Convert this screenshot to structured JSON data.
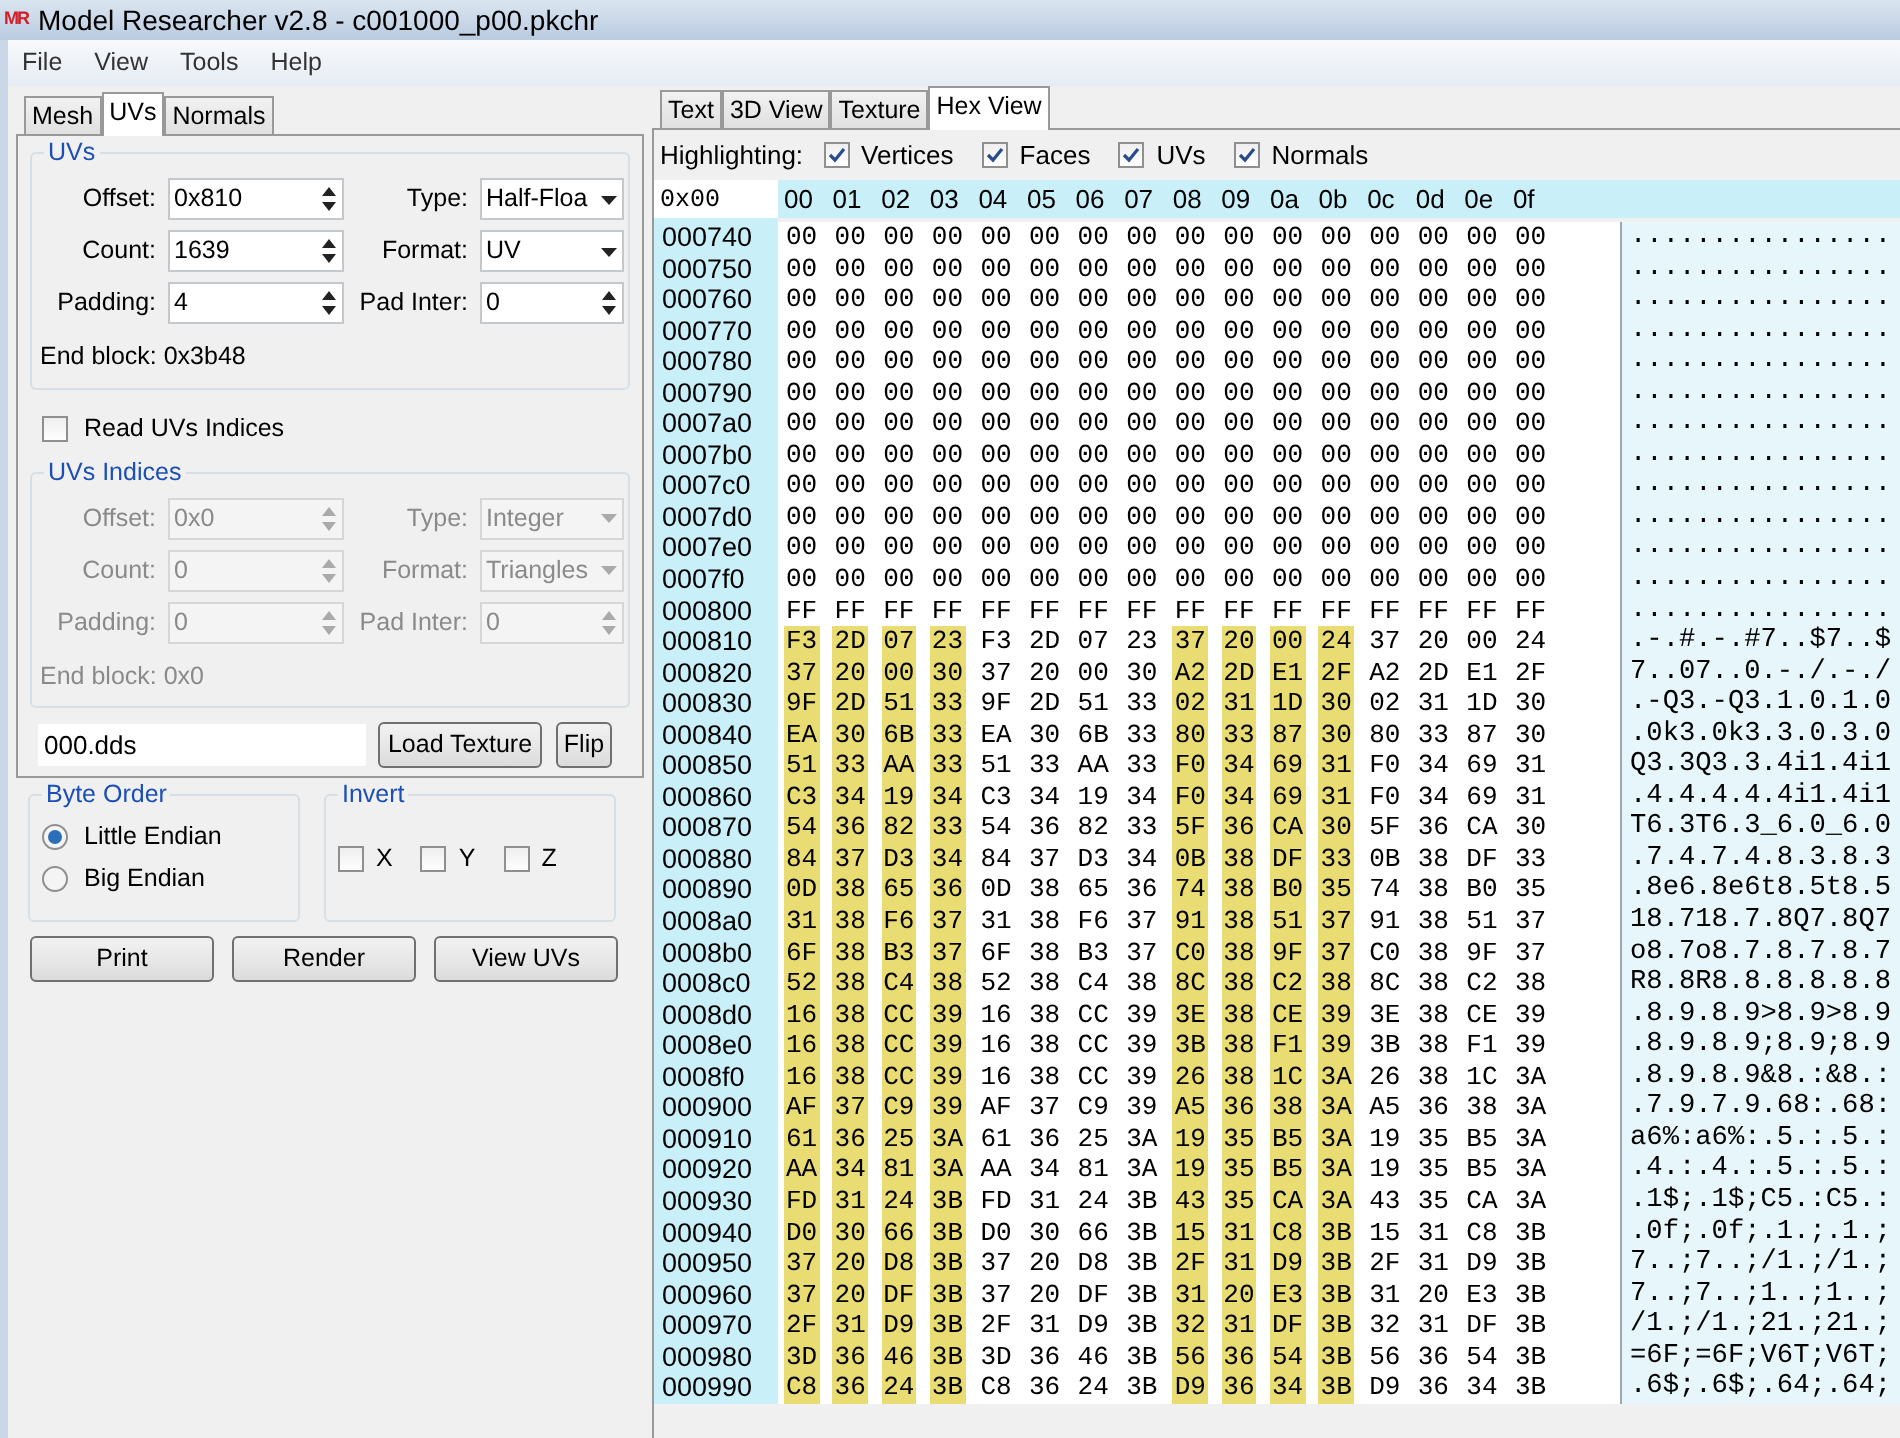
{
  "window": {
    "logo": "MR",
    "title": "Model Researcher v2.8 - c001000_p00.pkchr"
  },
  "menu": [
    "File",
    "View",
    "Tools",
    "Help"
  ],
  "left_tabs": [
    {
      "label": "Mesh",
      "selected": false
    },
    {
      "label": "UVs",
      "selected": true
    },
    {
      "label": "Normals",
      "selected": false
    }
  ],
  "uvs": {
    "title": "UVs",
    "disabled": false,
    "fields": [
      {
        "label": "Offset:",
        "value": "0x810",
        "kind": "spin"
      },
      {
        "label": "Type:",
        "value": "Half-Floa",
        "kind": "combo"
      },
      {
        "label": "Count:",
        "value": "1639",
        "kind": "spin"
      },
      {
        "label": "Format:",
        "value": "UV",
        "kind": "combo"
      },
      {
        "label": "Padding:",
        "value": "4",
        "kind": "spin"
      },
      {
        "label": "Pad Inter:",
        "value": "0",
        "kind": "spin"
      }
    ],
    "end_block": "End block: 0x3b48"
  },
  "read_indices": {
    "label": "Read UVs Indices",
    "checked": false
  },
  "uv_indices": {
    "title": "UVs Indices",
    "disabled": true,
    "fields": [
      {
        "label": "Offset:",
        "value": "0x0",
        "kind": "spin"
      },
      {
        "label": "Type:",
        "value": "Integer",
        "kind": "combo"
      },
      {
        "label": "Count:",
        "value": "0",
        "kind": "spin"
      },
      {
        "label": "Format:",
        "value": "Triangles",
        "kind": "combo"
      },
      {
        "label": "Padding:",
        "value": "0",
        "kind": "spin"
      },
      {
        "label": "Pad Inter:",
        "value": "0",
        "kind": "spin"
      }
    ],
    "end_block": "End block: 0x0"
  },
  "texture": {
    "value": "000.dds",
    "buttons": [
      "Load Texture",
      "Flip"
    ]
  },
  "byte_order": {
    "title": "Byte Order",
    "options": [
      {
        "label": "Little Endian",
        "selected": true
      },
      {
        "label": "Big Endian",
        "selected": false
      }
    ]
  },
  "invert": {
    "title": "Invert",
    "options": [
      {
        "label": "X",
        "checked": false
      },
      {
        "label": "Y",
        "checked": false
      },
      {
        "label": "Z",
        "checked": false
      }
    ]
  },
  "buttons": [
    "Print",
    "Render",
    "View UVs"
  ],
  "view_tabs": [
    {
      "label": "Text",
      "selected": false
    },
    {
      "label": "3D View",
      "selected": false
    },
    {
      "label": "Texture",
      "selected": false
    },
    {
      "label": "Hex View",
      "selected": true
    }
  ],
  "highlighting": {
    "label": "Highlighting:",
    "options": [
      {
        "label": "Vertices",
        "checked": true
      },
      {
        "label": "Faces",
        "checked": true
      },
      {
        "label": "UVs",
        "checked": true
      },
      {
        "label": "Normals",
        "checked": true
      }
    ]
  },
  "hex": {
    "offset_field": "0x00",
    "columns": [
      "00",
      "01",
      "02",
      "03",
      "04",
      "05",
      "06",
      "07",
      "08",
      "09",
      "0a",
      "0b",
      "0c",
      "0d",
      "0e",
      "0f"
    ],
    "rows": [
      {
        "address": "000740",
        "bytes": "00 00 00 00 00 00 00 00 00 00 00 00 00 00 00 00",
        "highlighted": [
          false,
          false,
          false,
          false,
          false,
          false,
          false,
          false,
          false,
          false,
          false,
          false,
          false,
          false,
          false,
          false
        ],
        "ascii": "................"
      },
      {
        "address": "000750",
        "bytes": "00 00 00 00 00 00 00 00 00 00 00 00 00 00 00 00",
        "highlighted": [
          false,
          false,
          false,
          false,
          false,
          false,
          false,
          false,
          false,
          false,
          false,
          false,
          false,
          false,
          false,
          false
        ],
        "ascii": "................"
      },
      {
        "address": "000760",
        "bytes": "00 00 00 00 00 00 00 00 00 00 00 00 00 00 00 00",
        "highlighted": [
          false,
          false,
          false,
          false,
          false,
          false,
          false,
          false,
          false,
          false,
          false,
          false,
          false,
          false,
          false,
          false
        ],
        "ascii": "................"
      },
      {
        "address": "000770",
        "bytes": "00 00 00 00 00 00 00 00 00 00 00 00 00 00 00 00",
        "highlighted": [
          false,
          false,
          false,
          false,
          false,
          false,
          false,
          false,
          false,
          false,
          false,
          false,
          false,
          false,
          false,
          false
        ],
        "ascii": "................"
      },
      {
        "address": "000780",
        "bytes": "00 00 00 00 00 00 00 00 00 00 00 00 00 00 00 00",
        "highlighted": [
          false,
          false,
          false,
          false,
          false,
          false,
          false,
          false,
          false,
          false,
          false,
          false,
          false,
          false,
          false,
          false
        ],
        "ascii": "................"
      },
      {
        "address": "000790",
        "bytes": "00 00 00 00 00 00 00 00 00 00 00 00 00 00 00 00",
        "highlighted": [
          false,
          false,
          false,
          false,
          false,
          false,
          false,
          false,
          false,
          false,
          false,
          false,
          false,
          false,
          false,
          false
        ],
        "ascii": "................"
      },
      {
        "address": "0007a0",
        "bytes": "00 00 00 00 00 00 00 00 00 00 00 00 00 00 00 00",
        "highlighted": [
          false,
          false,
          false,
          false,
          false,
          false,
          false,
          false,
          false,
          false,
          false,
          false,
          false,
          false,
          false,
          false
        ],
        "ascii": "................"
      },
      {
        "address": "0007b0",
        "bytes": "00 00 00 00 00 00 00 00 00 00 00 00 00 00 00 00",
        "highlighted": [
          false,
          false,
          false,
          false,
          false,
          false,
          false,
          false,
          false,
          false,
          false,
          false,
          false,
          false,
          false,
          false
        ],
        "ascii": "................"
      },
      {
        "address": "0007c0",
        "bytes": "00 00 00 00 00 00 00 00 00 00 00 00 00 00 00 00",
        "highlighted": [
          false,
          false,
          false,
          false,
          false,
          false,
          false,
          false,
          false,
          false,
          false,
          false,
          false,
          false,
          false,
          false
        ],
        "ascii": "................"
      },
      {
        "address": "0007d0",
        "bytes": "00 00 00 00 00 00 00 00 00 00 00 00 00 00 00 00",
        "highlighted": [
          false,
          false,
          false,
          false,
          false,
          false,
          false,
          false,
          false,
          false,
          false,
          false,
          false,
          false,
          false,
          false
        ],
        "ascii": "................"
      },
      {
        "address": "0007e0",
        "bytes": "00 00 00 00 00 00 00 00 00 00 00 00 00 00 00 00",
        "highlighted": [
          false,
          false,
          false,
          false,
          false,
          false,
          false,
          false,
          false,
          false,
          false,
          false,
          false,
          false,
          false,
          false
        ],
        "ascii": "................"
      },
      {
        "address": "0007f0",
        "bytes": "00 00 00 00 00 00 00 00 00 00 00 00 00 00 00 00",
        "highlighted": [
          false,
          false,
          false,
          false,
          false,
          false,
          false,
          false,
          false,
          false,
          false,
          false,
          false,
          false,
          false,
          false
        ],
        "ascii": "................"
      },
      {
        "address": "000800",
        "bytes": "FF FF FF FF FF FF FF FF FF FF FF FF FF FF FF FF",
        "highlighted": [
          false,
          false,
          false,
          false,
          false,
          false,
          false,
          false,
          false,
          false,
          false,
          false,
          false,
          false,
          false,
          false
        ],
        "ascii": "................"
      },
      {
        "address": "000810",
        "bytes": "F3 2D 07 23 F3 2D 07 23 37 20 00 24 37 20 00 24",
        "highlighted": [
          true,
          true,
          true,
          true,
          false,
          false,
          false,
          false,
          true,
          true,
          true,
          true,
          false,
          false,
          false,
          false
        ],
        "ascii": ".-.#.-.#7..$7..$"
      },
      {
        "address": "000820",
        "bytes": "37 20 00 30 37 20 00 30 A2 2D E1 2F A2 2D E1 2F",
        "highlighted": [
          true,
          true,
          true,
          true,
          false,
          false,
          false,
          false,
          true,
          true,
          true,
          true,
          false,
          false,
          false,
          false
        ],
        "ascii": "7..07..0.-./.-./"
      },
      {
        "address": "000830",
        "bytes": "9F 2D 51 33 9F 2D 51 33 02 31 1D 30 02 31 1D 30",
        "highlighted": [
          true,
          true,
          true,
          true,
          false,
          false,
          false,
          false,
          true,
          true,
          true,
          true,
          false,
          false,
          false,
          false
        ],
        "ascii": ".-Q3.-Q3.1.0.1.0"
      },
      {
        "address": "000840",
        "bytes": "EA 30 6B 33 EA 30 6B 33 80 33 87 30 80 33 87 30",
        "highlighted": [
          true,
          true,
          true,
          true,
          false,
          false,
          false,
          false,
          true,
          true,
          true,
          true,
          false,
          false,
          false,
          false
        ],
        "ascii": ".0k3.0k3.3.0.3.0"
      },
      {
        "address": "000850",
        "bytes": "51 33 AA 33 51 33 AA 33 F0 34 69 31 F0 34 69 31",
        "highlighted": [
          true,
          true,
          true,
          true,
          false,
          false,
          false,
          false,
          true,
          true,
          true,
          true,
          false,
          false,
          false,
          false
        ],
        "ascii": "Q3.3Q3.3.4i1.4i1"
      },
      {
        "address": "000860",
        "bytes": "C3 34 19 34 C3 34 19 34 F0 34 69 31 F0 34 69 31",
        "highlighted": [
          true,
          true,
          true,
          true,
          false,
          false,
          false,
          false,
          true,
          true,
          true,
          true,
          false,
          false,
          false,
          false
        ],
        "ascii": ".4.4.4.4.4i1.4i1"
      },
      {
        "address": "000870",
        "bytes": "54 36 82 33 54 36 82 33 5F 36 CA 30 5F 36 CA 30",
        "highlighted": [
          true,
          true,
          true,
          true,
          false,
          false,
          false,
          false,
          true,
          true,
          true,
          true,
          false,
          false,
          false,
          false
        ],
        "ascii": "T6.3T6.3_6.0_6.0"
      },
      {
        "address": "000880",
        "bytes": "84 37 D3 34 84 37 D3 34 0B 38 DF 33 0B 38 DF 33",
        "highlighted": [
          true,
          true,
          true,
          true,
          false,
          false,
          false,
          false,
          true,
          true,
          true,
          true,
          false,
          false,
          false,
          false
        ],
        "ascii": ".7.4.7.4.8.3.8.3"
      },
      {
        "address": "000890",
        "bytes": "0D 38 65 36 0D 38 65 36 74 38 B0 35 74 38 B0 35",
        "highlighted": [
          true,
          true,
          true,
          true,
          false,
          false,
          false,
          false,
          true,
          true,
          true,
          true,
          false,
          false,
          false,
          false
        ],
        "ascii": ".8e6.8e6t8.5t8.5"
      },
      {
        "address": "0008a0",
        "bytes": "31 38 F6 37 31 38 F6 37 91 38 51 37 91 38 51 37",
        "highlighted": [
          true,
          true,
          true,
          true,
          false,
          false,
          false,
          false,
          true,
          true,
          true,
          true,
          false,
          false,
          false,
          false
        ],
        "ascii": "18.718.7.8Q7.8Q7"
      },
      {
        "address": "0008b0",
        "bytes": "6F 38 B3 37 6F 38 B3 37 C0 38 9F 37 C0 38 9F 37",
        "highlighted": [
          true,
          true,
          true,
          true,
          false,
          false,
          false,
          false,
          true,
          true,
          true,
          true,
          false,
          false,
          false,
          false
        ],
        "ascii": "o8.7o8.7.8.7.8.7"
      },
      {
        "address": "0008c0",
        "bytes": "52 38 C4 38 52 38 C4 38 8C 38 C2 38 8C 38 C2 38",
        "highlighted": [
          true,
          true,
          true,
          true,
          false,
          false,
          false,
          false,
          true,
          true,
          true,
          true,
          false,
          false,
          false,
          false
        ],
        "ascii": "R8.8R8.8.8.8.8.8"
      },
      {
        "address": "0008d0",
        "bytes": "16 38 CC 39 16 38 CC 39 3E 38 CE 39 3E 38 CE 39",
        "highlighted": [
          true,
          true,
          true,
          true,
          false,
          false,
          false,
          false,
          true,
          true,
          true,
          true,
          false,
          false,
          false,
          false
        ],
        "ascii": ".8.9.8.9>8.9>8.9"
      },
      {
        "address": "0008e0",
        "bytes": "16 38 CC 39 16 38 CC 39 3B 38 F1 39 3B 38 F1 39",
        "highlighted": [
          true,
          true,
          true,
          true,
          false,
          false,
          false,
          false,
          true,
          true,
          true,
          true,
          false,
          false,
          false,
          false
        ],
        "ascii": ".8.9.8.9;8.9;8.9"
      },
      {
        "address": "0008f0",
        "bytes": "16 38 CC 39 16 38 CC 39 26 38 1C 3A 26 38 1C 3A",
        "highlighted": [
          true,
          true,
          true,
          true,
          false,
          false,
          false,
          false,
          true,
          true,
          true,
          true,
          false,
          false,
          false,
          false
        ],
        "ascii": ".8.9.8.9&8.:&8.:"
      },
      {
        "address": "000900",
        "bytes": "AF 37 C9 39 AF 37 C9 39 A5 36 38 3A A5 36 38 3A",
        "highlighted": [
          true,
          true,
          true,
          true,
          false,
          false,
          false,
          false,
          true,
          true,
          true,
          true,
          false,
          false,
          false,
          false
        ],
        "ascii": ".7.9.7.9.68:.68:"
      },
      {
        "address": "000910",
        "bytes": "61 36 25 3A 61 36 25 3A 19 35 B5 3A 19 35 B5 3A",
        "highlighted": [
          true,
          true,
          true,
          true,
          false,
          false,
          false,
          false,
          true,
          true,
          true,
          true,
          false,
          false,
          false,
          false
        ],
        "ascii": "a6%:a6%:.5.:.5.:"
      },
      {
        "address": "000920",
        "bytes": "AA 34 81 3A AA 34 81 3A 19 35 B5 3A 19 35 B5 3A",
        "highlighted": [
          true,
          true,
          true,
          true,
          false,
          false,
          false,
          false,
          true,
          true,
          true,
          true,
          false,
          false,
          false,
          false
        ],
        "ascii": ".4.:.4.:.5.:.5.:"
      },
      {
        "address": "000930",
        "bytes": "FD 31 24 3B FD 31 24 3B 43 35 CA 3A 43 35 CA 3A",
        "highlighted": [
          true,
          true,
          true,
          true,
          false,
          false,
          false,
          false,
          true,
          true,
          true,
          true,
          false,
          false,
          false,
          false
        ],
        "ascii": ".1$;.1$;C5.:C5.:"
      },
      {
        "address": "000940",
        "bytes": "D0 30 66 3B D0 30 66 3B 15 31 C8 3B 15 31 C8 3B",
        "highlighted": [
          true,
          true,
          true,
          true,
          false,
          false,
          false,
          false,
          true,
          true,
          true,
          true,
          false,
          false,
          false,
          false
        ],
        "ascii": ".0f;.0f;.1.;.1.;"
      },
      {
        "address": "000950",
        "bytes": "37 20 D8 3B 37 20 D8 3B 2F 31 D9 3B 2F 31 D9 3B",
        "highlighted": [
          true,
          true,
          true,
          true,
          false,
          false,
          false,
          false,
          true,
          true,
          true,
          true,
          false,
          false,
          false,
          false
        ],
        "ascii": "7..;7..;/1.;/1.;"
      },
      {
        "address": "000960",
        "bytes": "37 20 DF 3B 37 20 DF 3B 31 20 E3 3B 31 20 E3 3B",
        "highlighted": [
          true,
          true,
          true,
          true,
          false,
          false,
          false,
          false,
          true,
          true,
          true,
          true,
          false,
          false,
          false,
          false
        ],
        "ascii": "7..;7..;1..;1..;"
      },
      {
        "address": "000970",
        "bytes": "2F 31 D9 3B 2F 31 D9 3B 32 31 DF 3B 32 31 DF 3B",
        "highlighted": [
          true,
          true,
          true,
          true,
          false,
          false,
          false,
          false,
          true,
          true,
          true,
          true,
          false,
          false,
          false,
          false
        ],
        "ascii": "/1.;/1.;21.;21.;"
      },
      {
        "address": "000980",
        "bytes": "3D 36 46 3B 3D 36 46 3B 56 36 54 3B 56 36 54 3B",
        "highlighted": [
          true,
          true,
          true,
          true,
          false,
          false,
          false,
          false,
          true,
          true,
          true,
          true,
          false,
          false,
          false,
          false
        ],
        "ascii": "=6F;=6F;V6T;V6T;"
      },
      {
        "address": "000990",
        "bytes": "C8 36 24 3B C8 36 24 3B D9 36 34 3B D9 36 34 3B",
        "highlighted": [
          true,
          true,
          true,
          true,
          false,
          false,
          false,
          false,
          true,
          true,
          true,
          true,
          false,
          false,
          false,
          false
        ],
        "ascii": ".6$;.6$;.64;.64;"
      }
    ]
  }
}
